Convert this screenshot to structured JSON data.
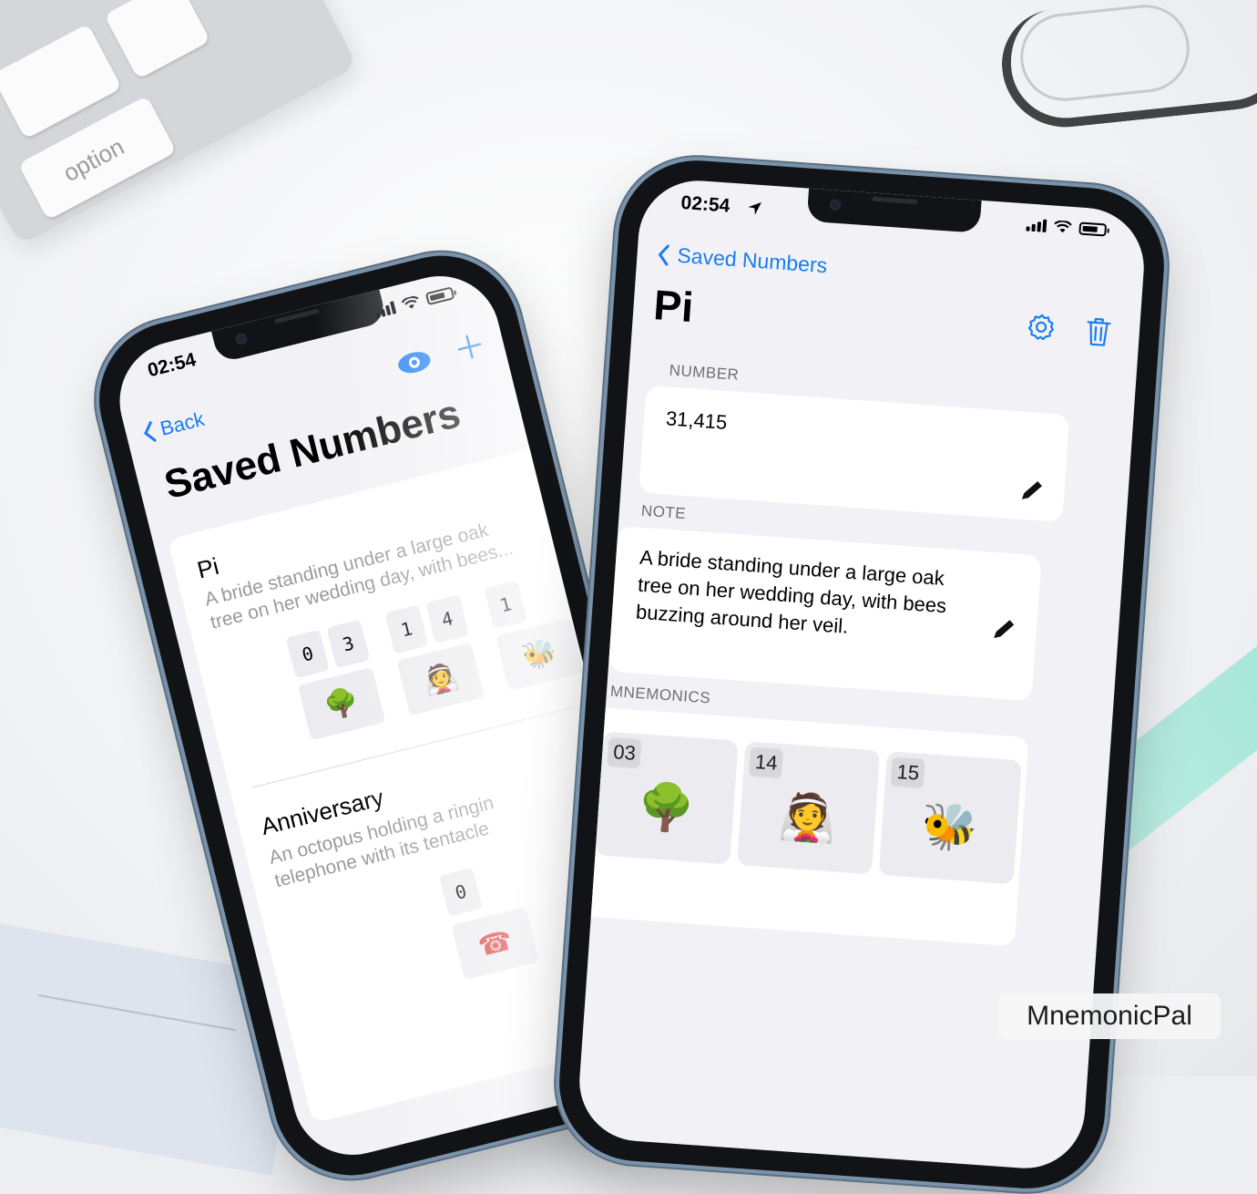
{
  "colors": {
    "accent": "#1a7cf2",
    "background": "#f2f2f6",
    "card": "#ffffff"
  },
  "keyboard": {
    "key_label": "option"
  },
  "left_screen": {
    "status": {
      "time": "02:54"
    },
    "nav": {
      "back_label": "Back",
      "eye_icon": "eye-icon",
      "add_icon": "plus-icon"
    },
    "title": "Saved Numbers",
    "items": [
      {
        "title": "Pi",
        "desc_line1": "A bride standing under a large oak",
        "desc_line2": "tree on her wedding day, with bees...",
        "digits": [
          "0",
          "3",
          "1",
          "4",
          "1"
        ],
        "emojis": [
          "🌳",
          "👰",
          "🐝"
        ]
      },
      {
        "title": "Anniversary",
        "desc_line1": "An octopus holding a ringin",
        "desc_line2": "telephone with its tentacle",
        "digits": [
          "0"
        ],
        "emojis": [
          "☎"
        ]
      }
    ]
  },
  "right_screen": {
    "status": {
      "time": "02:54"
    },
    "nav": {
      "back_label": "Saved Numbers",
      "settings_icon": "gear-icon",
      "delete_icon": "trash-icon"
    },
    "title": "Pi",
    "number_label": "NUMBER",
    "number_value": "31,415",
    "note_label": "NOTE",
    "note_line1": "A bride standing under a large oak",
    "note_line2": "tree on her wedding day, with bees",
    "note_line3": "buzzing around her veil.",
    "mnemonics_label": "MNEMONICS",
    "mnemonics": [
      {
        "num": "03",
        "emoji": "🌳"
      },
      {
        "num": "14",
        "emoji": "👰"
      },
      {
        "num": "15",
        "emoji": "🐝"
      }
    ]
  },
  "watermark": "MnemonicPal"
}
